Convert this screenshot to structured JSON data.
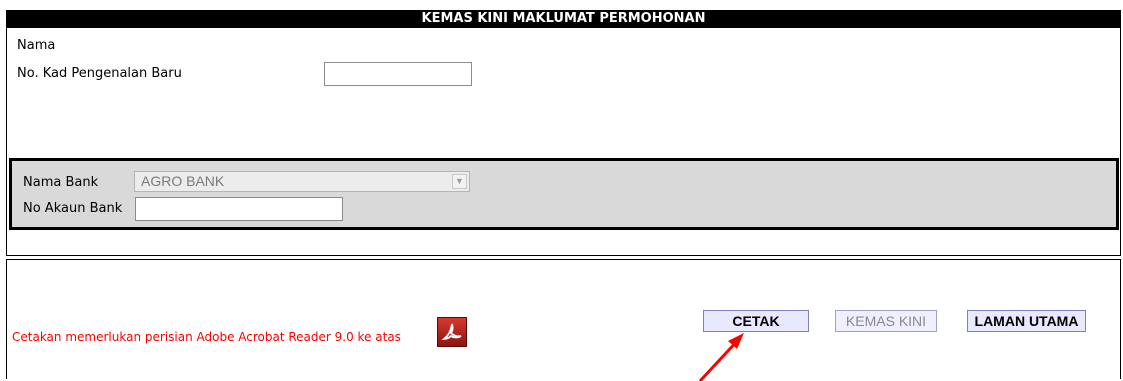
{
  "title": "KEMAS KINI MAKLUMAT PERMOHONAN",
  "form": {
    "nama_label": "Nama",
    "ic_label": "No. Kad Pengenalan Baru",
    "ic_value": ""
  },
  "bank": {
    "nama_bank_label": "Nama Bank",
    "nama_bank_value": "AGRO BANK",
    "no_akaun_label": "No Akaun Bank",
    "no_akaun_value": ""
  },
  "notice": "Cetakan memerlukan perisian Adobe Acrobat Reader 9.0 ke atas",
  "buttons": {
    "cetak": "CETAK",
    "kemas_kini": "KEMAS KINI",
    "laman_utama": "LAMAN UTAMA"
  },
  "icons": {
    "pdf": "adobe-acrobat-icon",
    "select_arrow": "chevron-down-icon",
    "annotation": "arrow-icon"
  },
  "colors": {
    "title_bg": "#000000",
    "bank_panel_bg": "#d9d9d9",
    "notice_text": "#ff0000",
    "button_bg": "#e8e8ff",
    "annotation_arrow": "#ff0000"
  }
}
